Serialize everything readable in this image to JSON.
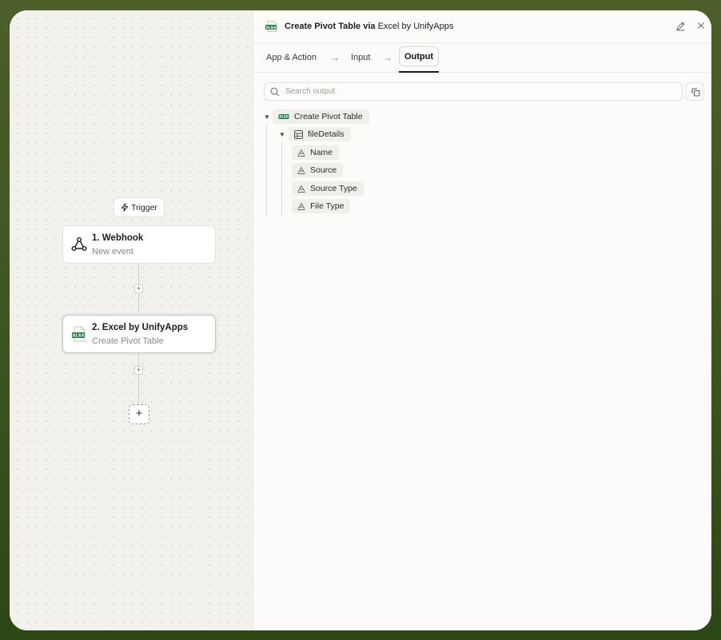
{
  "canvas": {
    "trigger_label": "Trigger",
    "steps": [
      {
        "title": "1. Webhook",
        "subtitle": "New event",
        "icon": "webhook-icon"
      },
      {
        "title": "2. Excel by UnifyApps",
        "subtitle": "Create Pivot Table",
        "icon": "xlsx-icon"
      }
    ],
    "add_step_symbol": "+"
  },
  "panel": {
    "title_action": "Create Pivot Table via",
    "title_app": "Excel by UnifyApps",
    "tabs": [
      "App & Action",
      "Input",
      "Output"
    ],
    "active_tab": "Output",
    "search_placeholder": "Search output",
    "tree": {
      "root": "Create Pivot Table",
      "group": "fileDetails",
      "fields": [
        "Name",
        "Source",
        "Source Type",
        "File Type"
      ]
    }
  },
  "colors": {
    "frame_green": "#3d5420",
    "xlsx_green": "#1e7b45"
  }
}
